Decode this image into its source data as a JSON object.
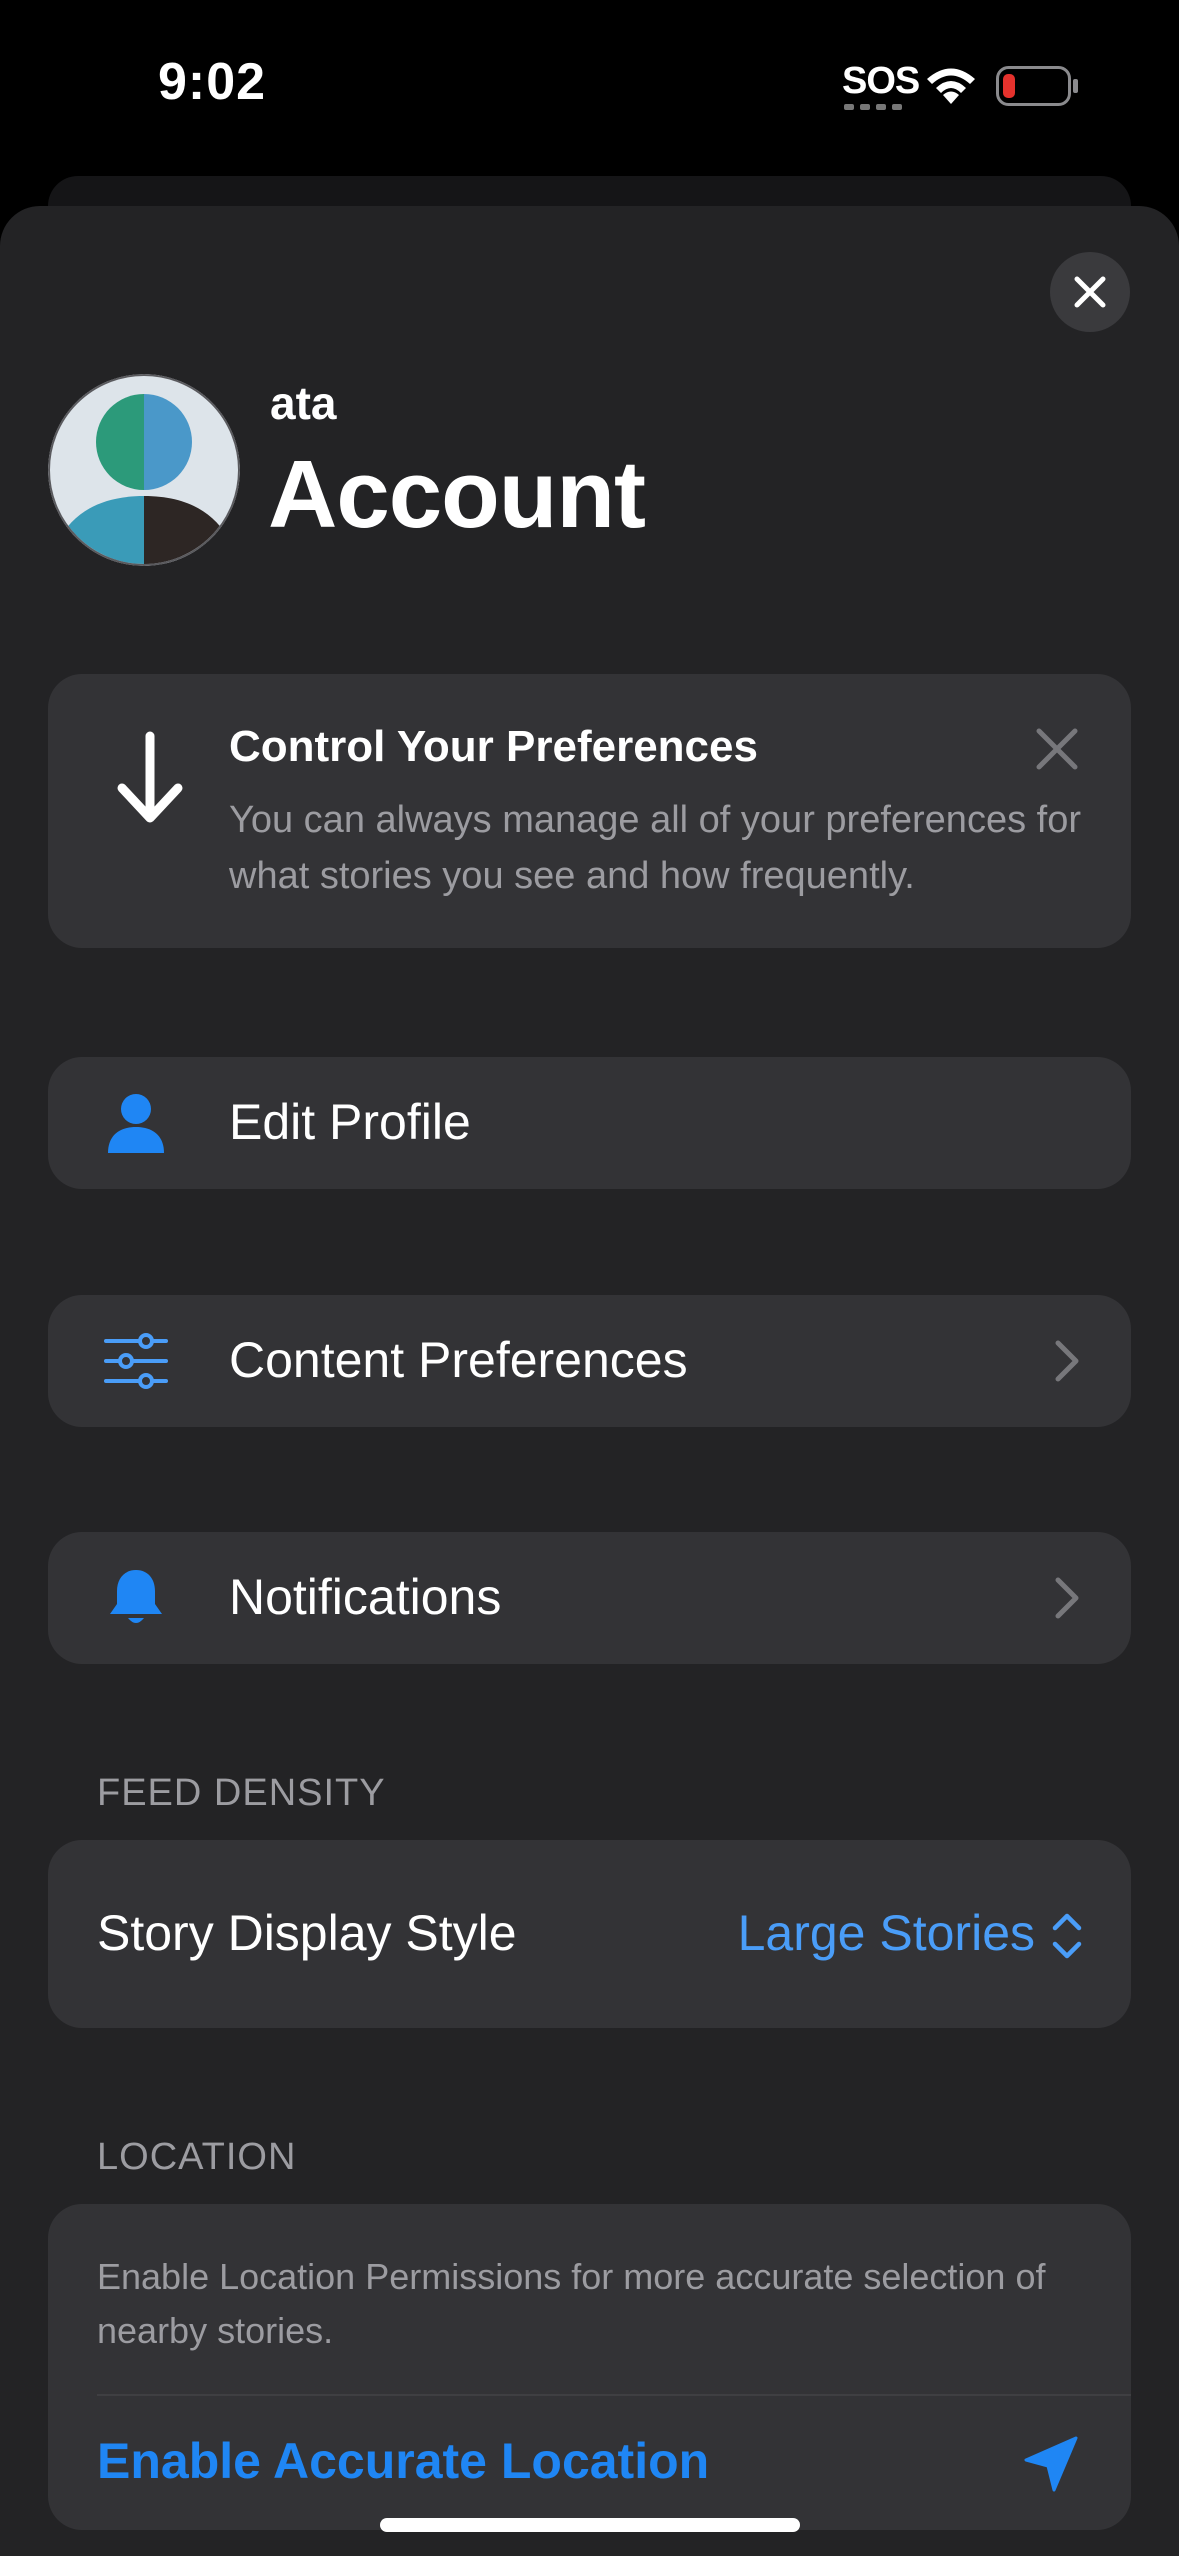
{
  "status_bar": {
    "time": "9:02",
    "sos": "SOS",
    "battery_color": "#e5322d"
  },
  "header": {
    "username": "ata",
    "title": "Account"
  },
  "promo": {
    "title": "Control Your Preferences",
    "body": "You can always manage all of your preferences for what stories you see and how frequently."
  },
  "menu": {
    "edit_profile": "Edit Profile",
    "content_preferences": "Content Preferences",
    "notifications": "Notifications"
  },
  "feed_density": {
    "header": "FEED DENSITY",
    "label": "Story Display Style",
    "value": "Large Stories"
  },
  "location": {
    "header": "LOCATION",
    "description": "Enable Location Permissions for more accurate selection of nearby stories.",
    "action": "Enable Accurate Location"
  },
  "colors": {
    "accent": "#1f86f4",
    "sheet_bg": "#232325",
    "card_bg": "#333336",
    "secondary_text": "#9c9ca1"
  }
}
